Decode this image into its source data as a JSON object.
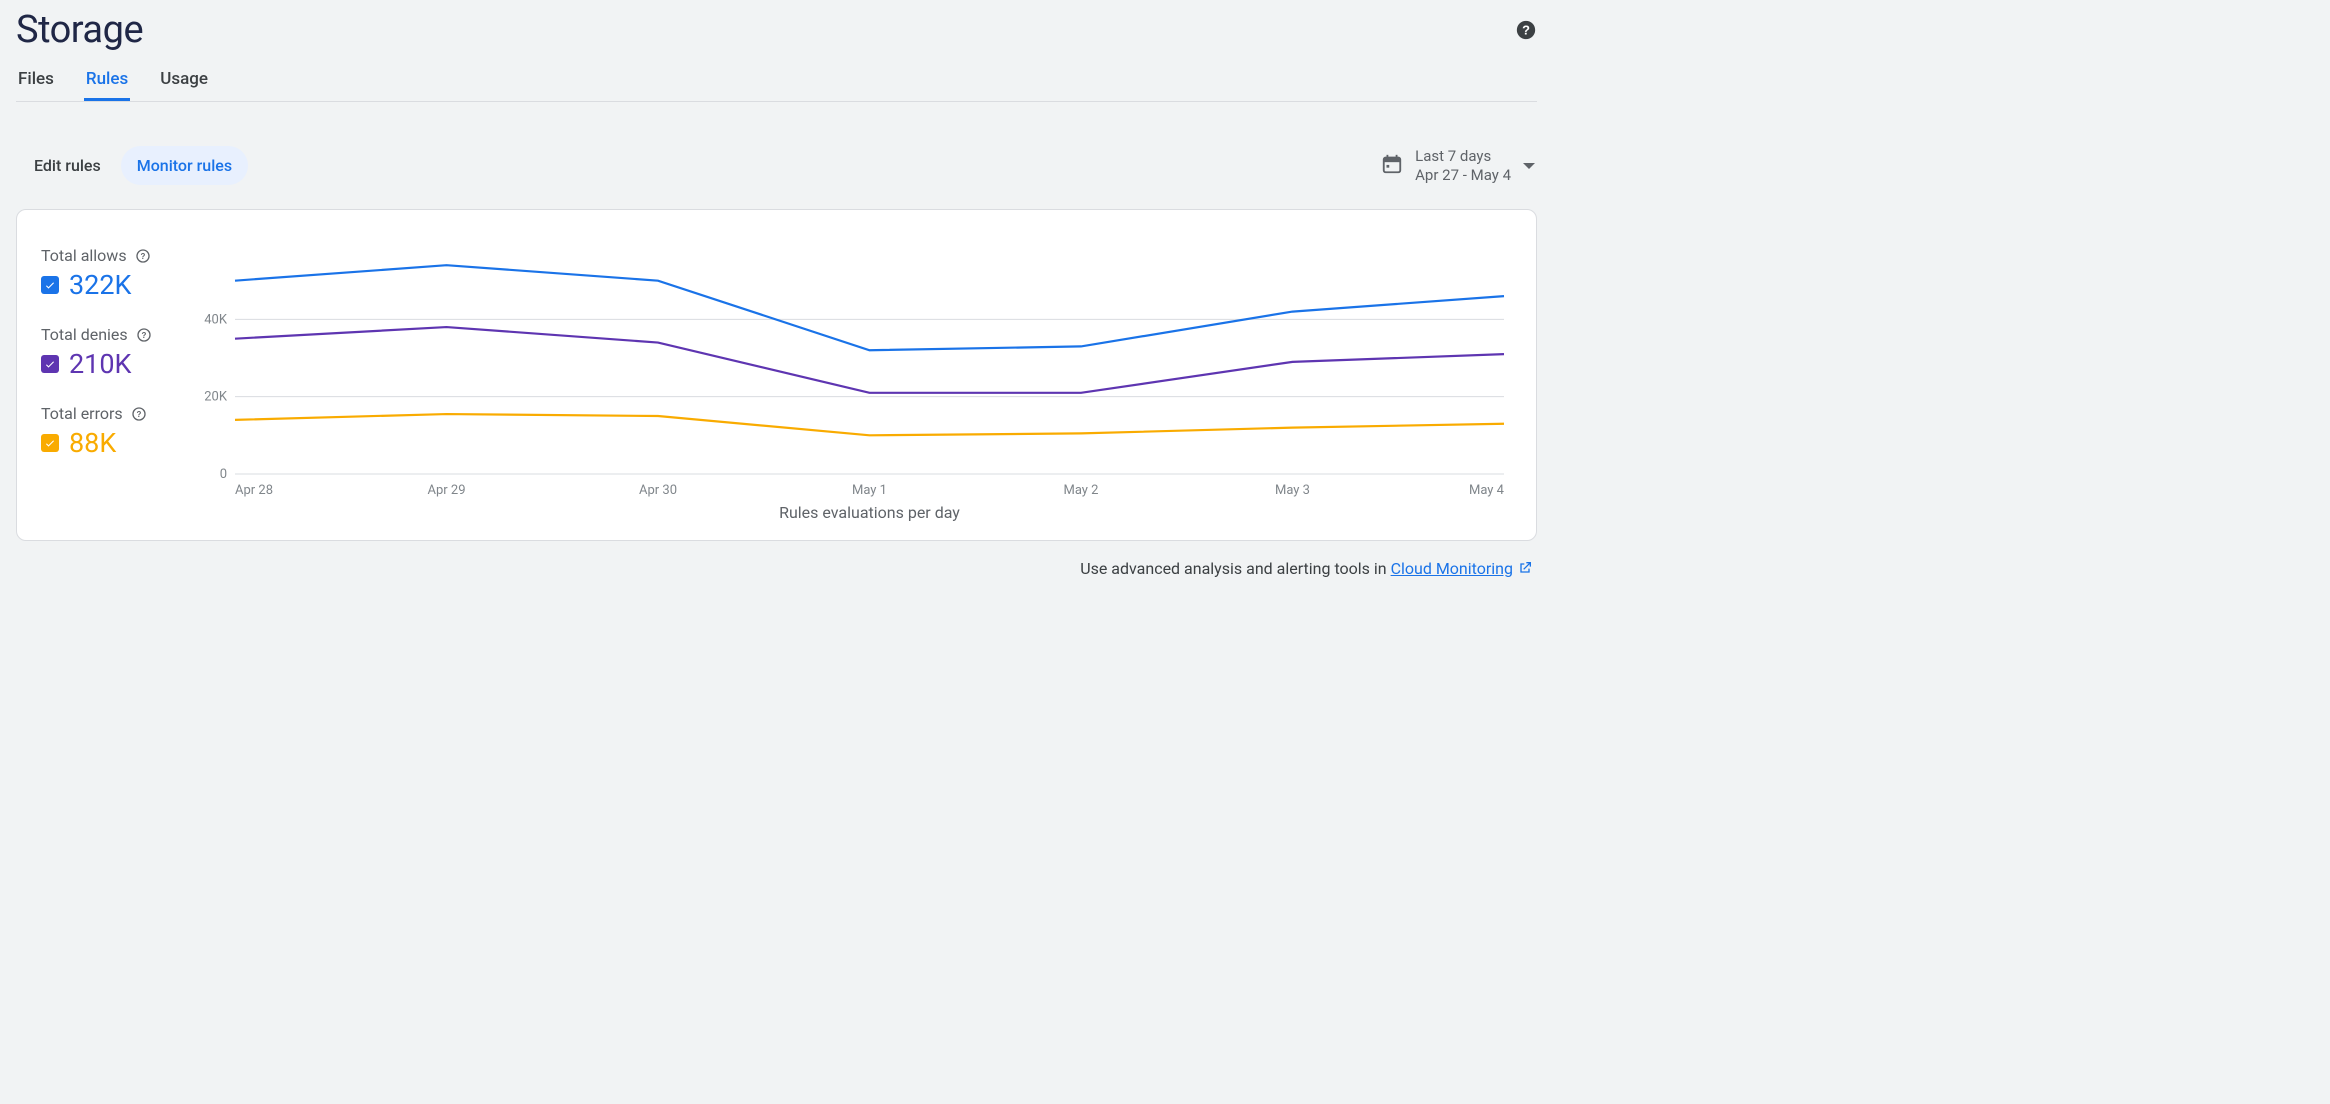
{
  "page_title": "Storage",
  "tabs": [
    {
      "id": "files",
      "label": "Files",
      "active": false
    },
    {
      "id": "rules",
      "label": "Rules",
      "active": true
    },
    {
      "id": "usage",
      "label": "Usage",
      "active": false
    }
  ],
  "sub_tabs": [
    {
      "id": "edit",
      "label": "Edit rules",
      "active": false
    },
    {
      "id": "monitor",
      "label": "Monitor rules",
      "active": true
    }
  ],
  "date_picker": {
    "range_label": "Last 7 days",
    "range_detail": "Apr 27 - May 4"
  },
  "legend": {
    "allows": {
      "label": "Total allows",
      "value": "322K",
      "color": "#1a73e8"
    },
    "denies": {
      "label": "Total denies",
      "value": "210K",
      "color": "#5e35b1"
    },
    "errors": {
      "label": "Total errors",
      "value": "88K",
      "color": "#f9ab00"
    }
  },
  "chart_data": {
    "type": "line",
    "title": "",
    "xlabel": "Rules evaluations per day",
    "ylabel": "",
    "ylim": [
      0,
      60000
    ],
    "y_ticks": [
      0,
      20000,
      40000
    ],
    "y_tick_labels": [
      "0",
      "20K",
      "40K"
    ],
    "categories": [
      "Apr 28",
      "Apr 29",
      "Apr 30",
      "May 1",
      "May 2",
      "May 3",
      "May 4"
    ],
    "series": [
      {
        "name": "Total allows",
        "color": "#1a73e8",
        "values": [
          50000,
          54000,
          50000,
          32000,
          33000,
          42000,
          46000
        ]
      },
      {
        "name": "Total denies",
        "color": "#5e35b1",
        "values": [
          35000,
          38000,
          34000,
          21000,
          21000,
          29000,
          31000
        ]
      },
      {
        "name": "Total errors",
        "color": "#f9ab00",
        "values": [
          14000,
          15500,
          15000,
          10000,
          10500,
          12000,
          13000
        ]
      }
    ]
  },
  "footer": {
    "prefix": "Use advanced analysis and alerting tools in ",
    "link_text": "Cloud Monitoring"
  }
}
